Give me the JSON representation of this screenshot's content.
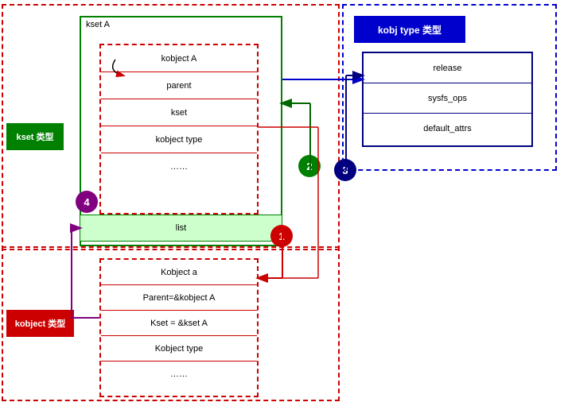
{
  "kset_type": {
    "label": "kset 类型"
  },
  "kobject_type": {
    "label": "kobject 类型"
  },
  "kobj_type": {
    "label": "kobj type 类型"
  },
  "kset_a": {
    "label": "kset A",
    "fields": [
      "kobject A",
      "parent",
      "kset",
      "kobject type",
      "……"
    ],
    "list_label": "list"
  },
  "kobj_fields": {
    "fields": [
      "release",
      "sysfs_ops",
      "default_attrs"
    ]
  },
  "kobject_a": {
    "fields": [
      "Kobject a",
      "Parent=&kobject A",
      "Kset = &kset A",
      "Kobject type",
      "……"
    ]
  },
  "badges": {
    "one": "1",
    "two": "2",
    "three": "3",
    "four": "4"
  }
}
